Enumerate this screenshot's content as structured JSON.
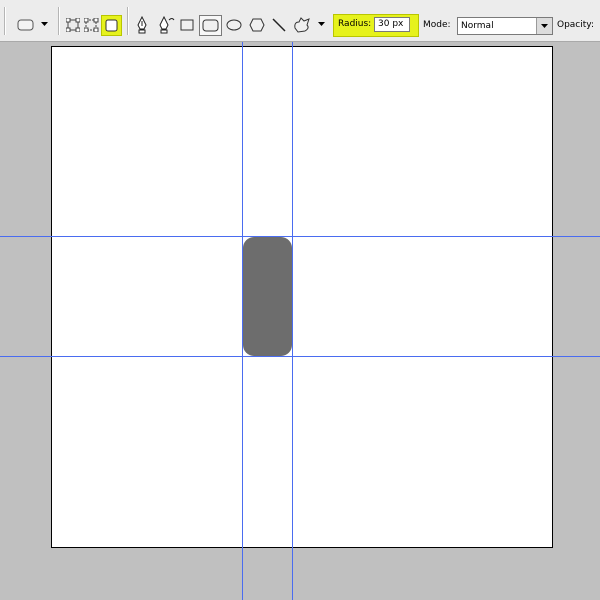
{
  "options_bar": {
    "tool_preset_icon": "rounded-rectangle-preset-icon",
    "tool_preset_dropdown_icon": "dropdown-arrow-icon",
    "mode_buttons": [
      {
        "name": "shape-layers-icon",
        "selected": false
      },
      {
        "name": "paths-icon",
        "selected": false
      },
      {
        "name": "fill-pixels-icon",
        "selected": true
      }
    ],
    "tool_buttons": [
      {
        "name": "pen-tool-icon",
        "selected": false
      },
      {
        "name": "freeform-pen-tool-icon",
        "selected": false
      },
      {
        "name": "rectangle-tool-icon",
        "selected": false
      },
      {
        "name": "rounded-rectangle-tool-icon",
        "selected": true
      },
      {
        "name": "ellipse-tool-icon",
        "selected": false
      },
      {
        "name": "polygon-tool-icon",
        "selected": false
      },
      {
        "name": "line-tool-icon",
        "selected": false
      },
      {
        "name": "custom-shape-tool-icon",
        "selected": false
      }
    ],
    "radius_label": "Radius:",
    "radius_value": "30 px",
    "mode_label": "Mode:",
    "mode_value": "Normal",
    "opacity_label": "Opacity:"
  },
  "document": {
    "shape": {
      "type": "rounded-rectangle",
      "fill_color": "#6d6d6d"
    }
  },
  "colors": {
    "highlight": "#e6f21c",
    "guide": "#4a6cf0",
    "workspace": "#c0c0c0",
    "canvas": "#ffffff",
    "shape_fill": "#6d6d6d"
  }
}
